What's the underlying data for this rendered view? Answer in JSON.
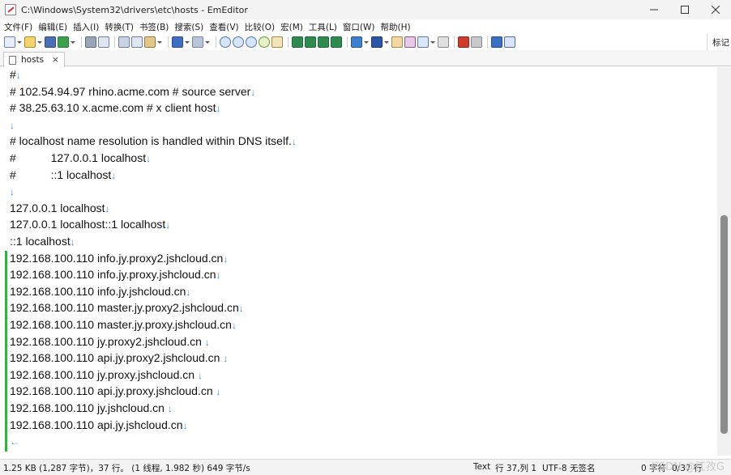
{
  "window": {
    "title": "C:\\Windows\\System32\\drivers\\etc\\hosts - EmEditor"
  },
  "menu": [
    {
      "label": "文件(F)"
    },
    {
      "label": "编辑(E)"
    },
    {
      "label": "插入(I)"
    },
    {
      "label": "转换(T)"
    },
    {
      "label": "书签(B)"
    },
    {
      "label": "搜索(S)"
    },
    {
      "label": "查看(V)"
    },
    {
      "label": "比较(O)"
    },
    {
      "label": "宏(M)"
    },
    {
      "label": "工具(L)"
    },
    {
      "label": "窗口(W)"
    },
    {
      "label": "帮助(H)"
    }
  ],
  "toolbar": {
    "right_label": "标记"
  },
  "tab": {
    "label": "hosts",
    "close": "×"
  },
  "editor": {
    "eol_glyph": "↓",
    "eof_glyph": "←",
    "lines": [
      {
        "text": "#",
        "modified": false
      },
      {
        "text": "# 102.54.94.97 rhino.acme.com # source server",
        "modified": false
      },
      {
        "text": "# 38.25.63.10 x.acme.com # x client host",
        "modified": false
      },
      {
        "text": "",
        "modified": false
      },
      {
        "text": "# localhost name resolution is handled within DNS itself.",
        "modified": false
      },
      {
        "text": "#           127.0.0.1 localhost",
        "modified": false
      },
      {
        "text": "#           ::1 localhost",
        "modified": false
      },
      {
        "text": "",
        "modified": false
      },
      {
        "text": "127.0.0.1 localhost",
        "modified": false
      },
      {
        "text": "127.0.0.1 localhost::1 localhost",
        "modified": false
      },
      {
        "text": "::1 localhost",
        "modified": false
      },
      {
        "text": "192.168.100.110 info.jy.proxy2.jshcloud.cn",
        "modified": true
      },
      {
        "text": "192.168.100.110 info.jy.proxy.jshcloud.cn",
        "modified": true
      },
      {
        "text": "192.168.100.110 info.jy.jshcloud.cn",
        "modified": true
      },
      {
        "text": "192.168.100.110 master.jy.proxy2.jshcloud.cn",
        "modified": true
      },
      {
        "text": "192.168.100.110 master.jy.proxy.jshcloud.cn",
        "modified": true
      },
      {
        "text": "192.168.100.110 jy.proxy2.jshcloud.cn ",
        "modified": true
      },
      {
        "text": "192.168.100.110 api.jy.proxy2.jshcloud.cn ",
        "modified": true
      },
      {
        "text": "192.168.100.110 jy.proxy.jshcloud.cn ",
        "modified": true
      },
      {
        "text": "192.168.100.110 api.jy.proxy.jshcloud.cn ",
        "modified": true
      },
      {
        "text": "192.168.100.110 jy.jshcloud.cn ",
        "modified": true
      },
      {
        "text": "192.168.100.110 api.jy.jshcloud.cn",
        "modified": true
      },
      {
        "text": "",
        "modified": true,
        "eof": true
      }
    ]
  },
  "status": {
    "file_info": "1.25 KB (1,287 字节)，37 行。 (1 线程, 1.982 秒) 649 字节/s",
    "mode": "Text",
    "position": "行 37,列 1",
    "encoding": "UTF-8 无签名",
    "selection": "0 字符",
    "lines": "0/37 行"
  },
  "watermark": "CSDN @江孜G",
  "colors": {
    "modified_marker": "#25b83a",
    "eol_marker": "#3b8fd6"
  }
}
